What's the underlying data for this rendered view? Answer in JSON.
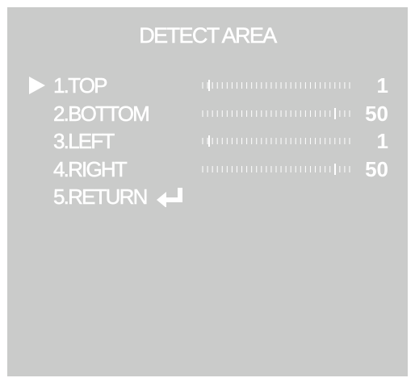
{
  "title": "DETECT AREA",
  "colors": {
    "background": "#cacbca",
    "text": "#ffffff"
  },
  "cursor_icon": "triangle-right-icon",
  "selected_index": 0,
  "slider_max": 50,
  "items": [
    {
      "label": "1.TOP",
      "value": "1",
      "slider_value": 1
    },
    {
      "label": "2.BOTTOM",
      "value": "50",
      "slider_value": 50
    },
    {
      "label": "3.LEFT",
      "value": "1",
      "slider_value": 1
    },
    {
      "label": "4.RIGHT",
      "value": "50",
      "slider_value": 50
    },
    {
      "label": "5.RETURN",
      "icon": "enter-return-icon"
    }
  ]
}
